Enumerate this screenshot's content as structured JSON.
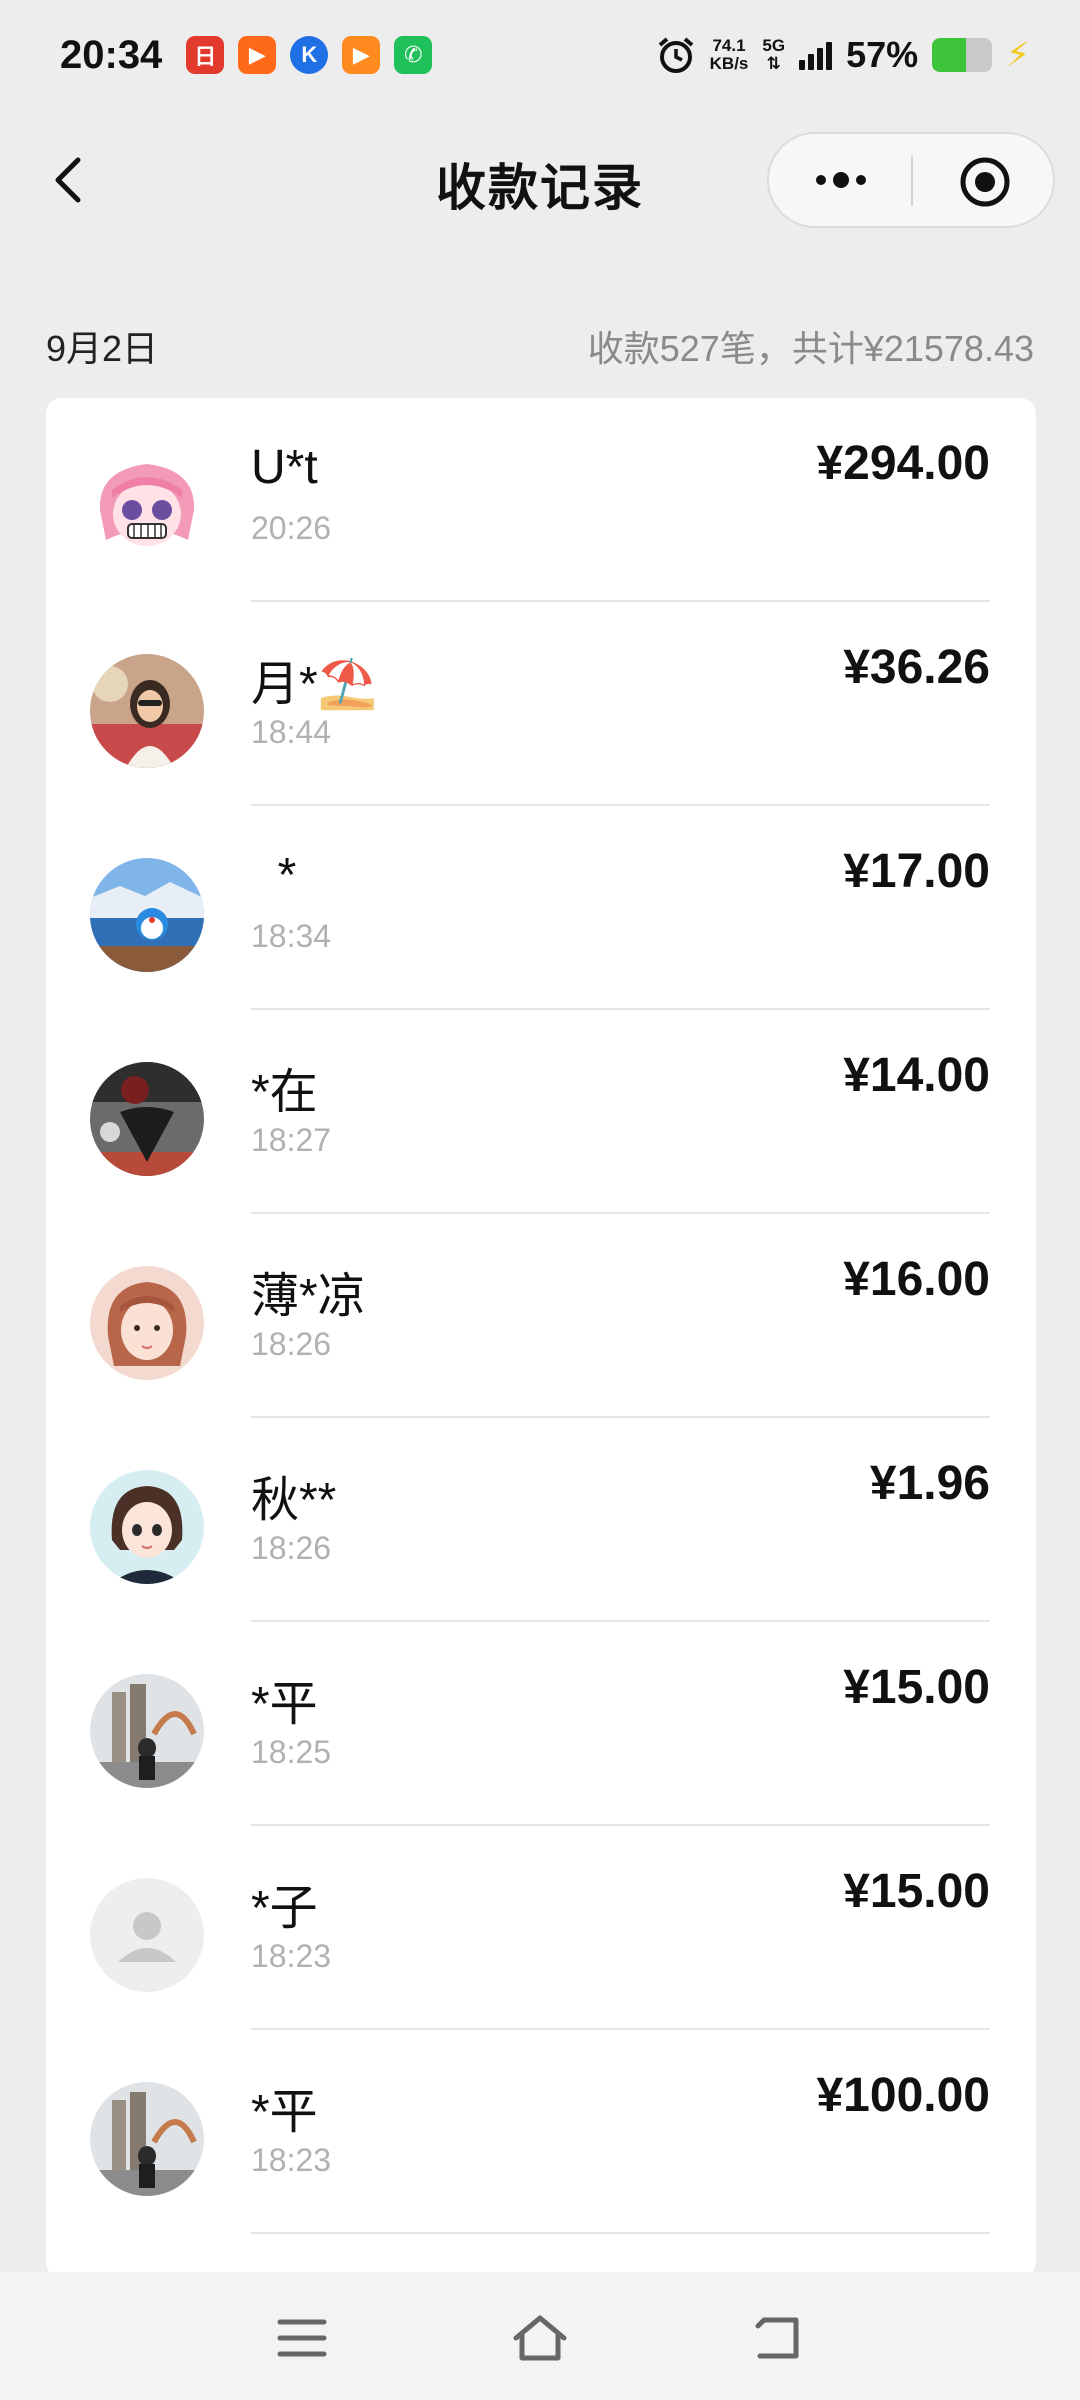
{
  "status_bar": {
    "time": "20:34",
    "net_speed_value": "74.1",
    "net_speed_unit": "KB/s",
    "network": "5G",
    "battery": "57%",
    "battery_level": 0.57,
    "app_icons": [
      {
        "icon": "calendar-app-icon",
        "color": "#e23b2e",
        "label": "日"
      },
      {
        "icon": "video-app-icon",
        "color": "#ff6a1a",
        "label": "▶"
      },
      {
        "icon": "k-app-icon",
        "color": "#1f6fe5",
        "label": "K"
      },
      {
        "icon": "video-app-icon-2",
        "color": "#ff8a1f",
        "label": "▶"
      },
      {
        "icon": "phone-app-icon",
        "color": "#20c05a",
        "label": "✆"
      }
    ]
  },
  "nav": {
    "title": "收款记录"
  },
  "summary": {
    "date": "9月2日",
    "total": "收款527笔，共计¥21578.43"
  },
  "records": [
    {
      "name": "U*t",
      "time": "20:26",
      "amount": "¥294.00",
      "avatar": "anime-girl-avatar"
    },
    {
      "name": "月*⛱️",
      "time": "18:44",
      "amount": "¥36.26",
      "avatar": "woman-photo-avatar"
    },
    {
      "name": "  *",
      "time": "18:34",
      "amount": "¥17.00",
      "avatar": "doraemon-avatar"
    },
    {
      "name": "*在",
      "time": "18:27",
      "amount": "¥14.00",
      "avatar": "dark-photo-avatar"
    },
    {
      "name": "薄*凉",
      "time": "18:26",
      "amount": "¥16.00",
      "avatar": "girl-portrait-avatar"
    },
    {
      "name": "秋**",
      "time": "18:26",
      "amount": "¥1.96",
      "avatar": "cartoon-girl-avatar"
    },
    {
      "name": "*平",
      "time": "18:25",
      "amount": "¥15.00",
      "avatar": "building-photo-avatar"
    },
    {
      "name": "*子",
      "time": "18:23",
      "amount": "¥15.00",
      "avatar": "default-user-avatar"
    },
    {
      "name": "*平",
      "time": "18:23",
      "amount": "¥100.00",
      "avatar": "building-photo-avatar"
    }
  ]
}
